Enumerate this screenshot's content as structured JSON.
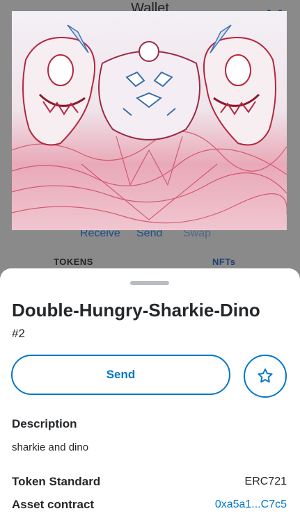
{
  "background": {
    "title": "Wallet",
    "actions": [
      "Receive",
      "Send",
      "Swap"
    ],
    "tabs": [
      "TOKENS",
      "NFTs"
    ]
  },
  "nft": {
    "name": "Double-Hungry-Sharkie-Dino",
    "token_id": "#2",
    "send_label": "Send",
    "favorite_icon": "star-icon",
    "description_label": "Description",
    "description": "sharkie and dino",
    "token_standard_label": "Token Standard",
    "token_standard": "ERC721",
    "asset_contract_label": "Asset contract",
    "asset_contract": "0xa5a1...C7c5"
  },
  "colors": {
    "accent": "#0376c9",
    "text": "#24272a"
  }
}
